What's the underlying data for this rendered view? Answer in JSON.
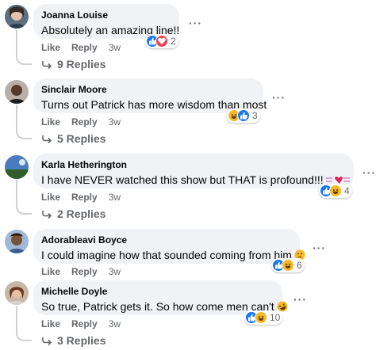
{
  "colors": {
    "like": "#1877f2",
    "love": "#f33e58",
    "haha": "#f7b928",
    "secondary_text": "#65676b",
    "bubble": "#f0f2f5"
  },
  "actions": {
    "like_label": "Like",
    "reply_label": "Reply"
  },
  "comments": [
    {
      "author": "Joanna Louise",
      "text": "Absolutely an amazing line!!",
      "reactions": [
        "like-icon",
        "love-icon"
      ],
      "reaction_count": "2",
      "time": "3w",
      "replies": "9 Replies"
    },
    {
      "author": "Sinclair Moore",
      "text": "Turns out Patrick has more wisdom than most",
      "reactions": [
        "haha-icon",
        "like-icon"
      ],
      "reaction_count": "3",
      "time": "3w",
      "replies": "5 Replies"
    },
    {
      "author": "Karla Hetherington",
      "text": "I have NEVER watched this show but THAT is profound!!!",
      "inline_emoji": "hearts-decoration-emoji",
      "reactions": [
        "like-icon",
        "haha-icon"
      ],
      "reaction_count": "4",
      "time": "3w",
      "replies": "2 Replies"
    },
    {
      "author": "Adorableavi Boyce",
      "text": "I could imagine how that sounded coming from him",
      "inline_emoji": "thinking-face-emoji",
      "reactions": [
        "like-icon",
        "haha-icon"
      ],
      "reaction_count": "6",
      "time": "3w"
    },
    {
      "author": "Michelle Doyle",
      "text": "So true, Patrick gets it. So how come men can't",
      "inline_emoji": "rolling-laughing-emoji",
      "reactions": [
        "like-icon",
        "haha-icon"
      ],
      "reaction_count": "10",
      "time": "3w",
      "replies": "3 Replies"
    }
  ]
}
